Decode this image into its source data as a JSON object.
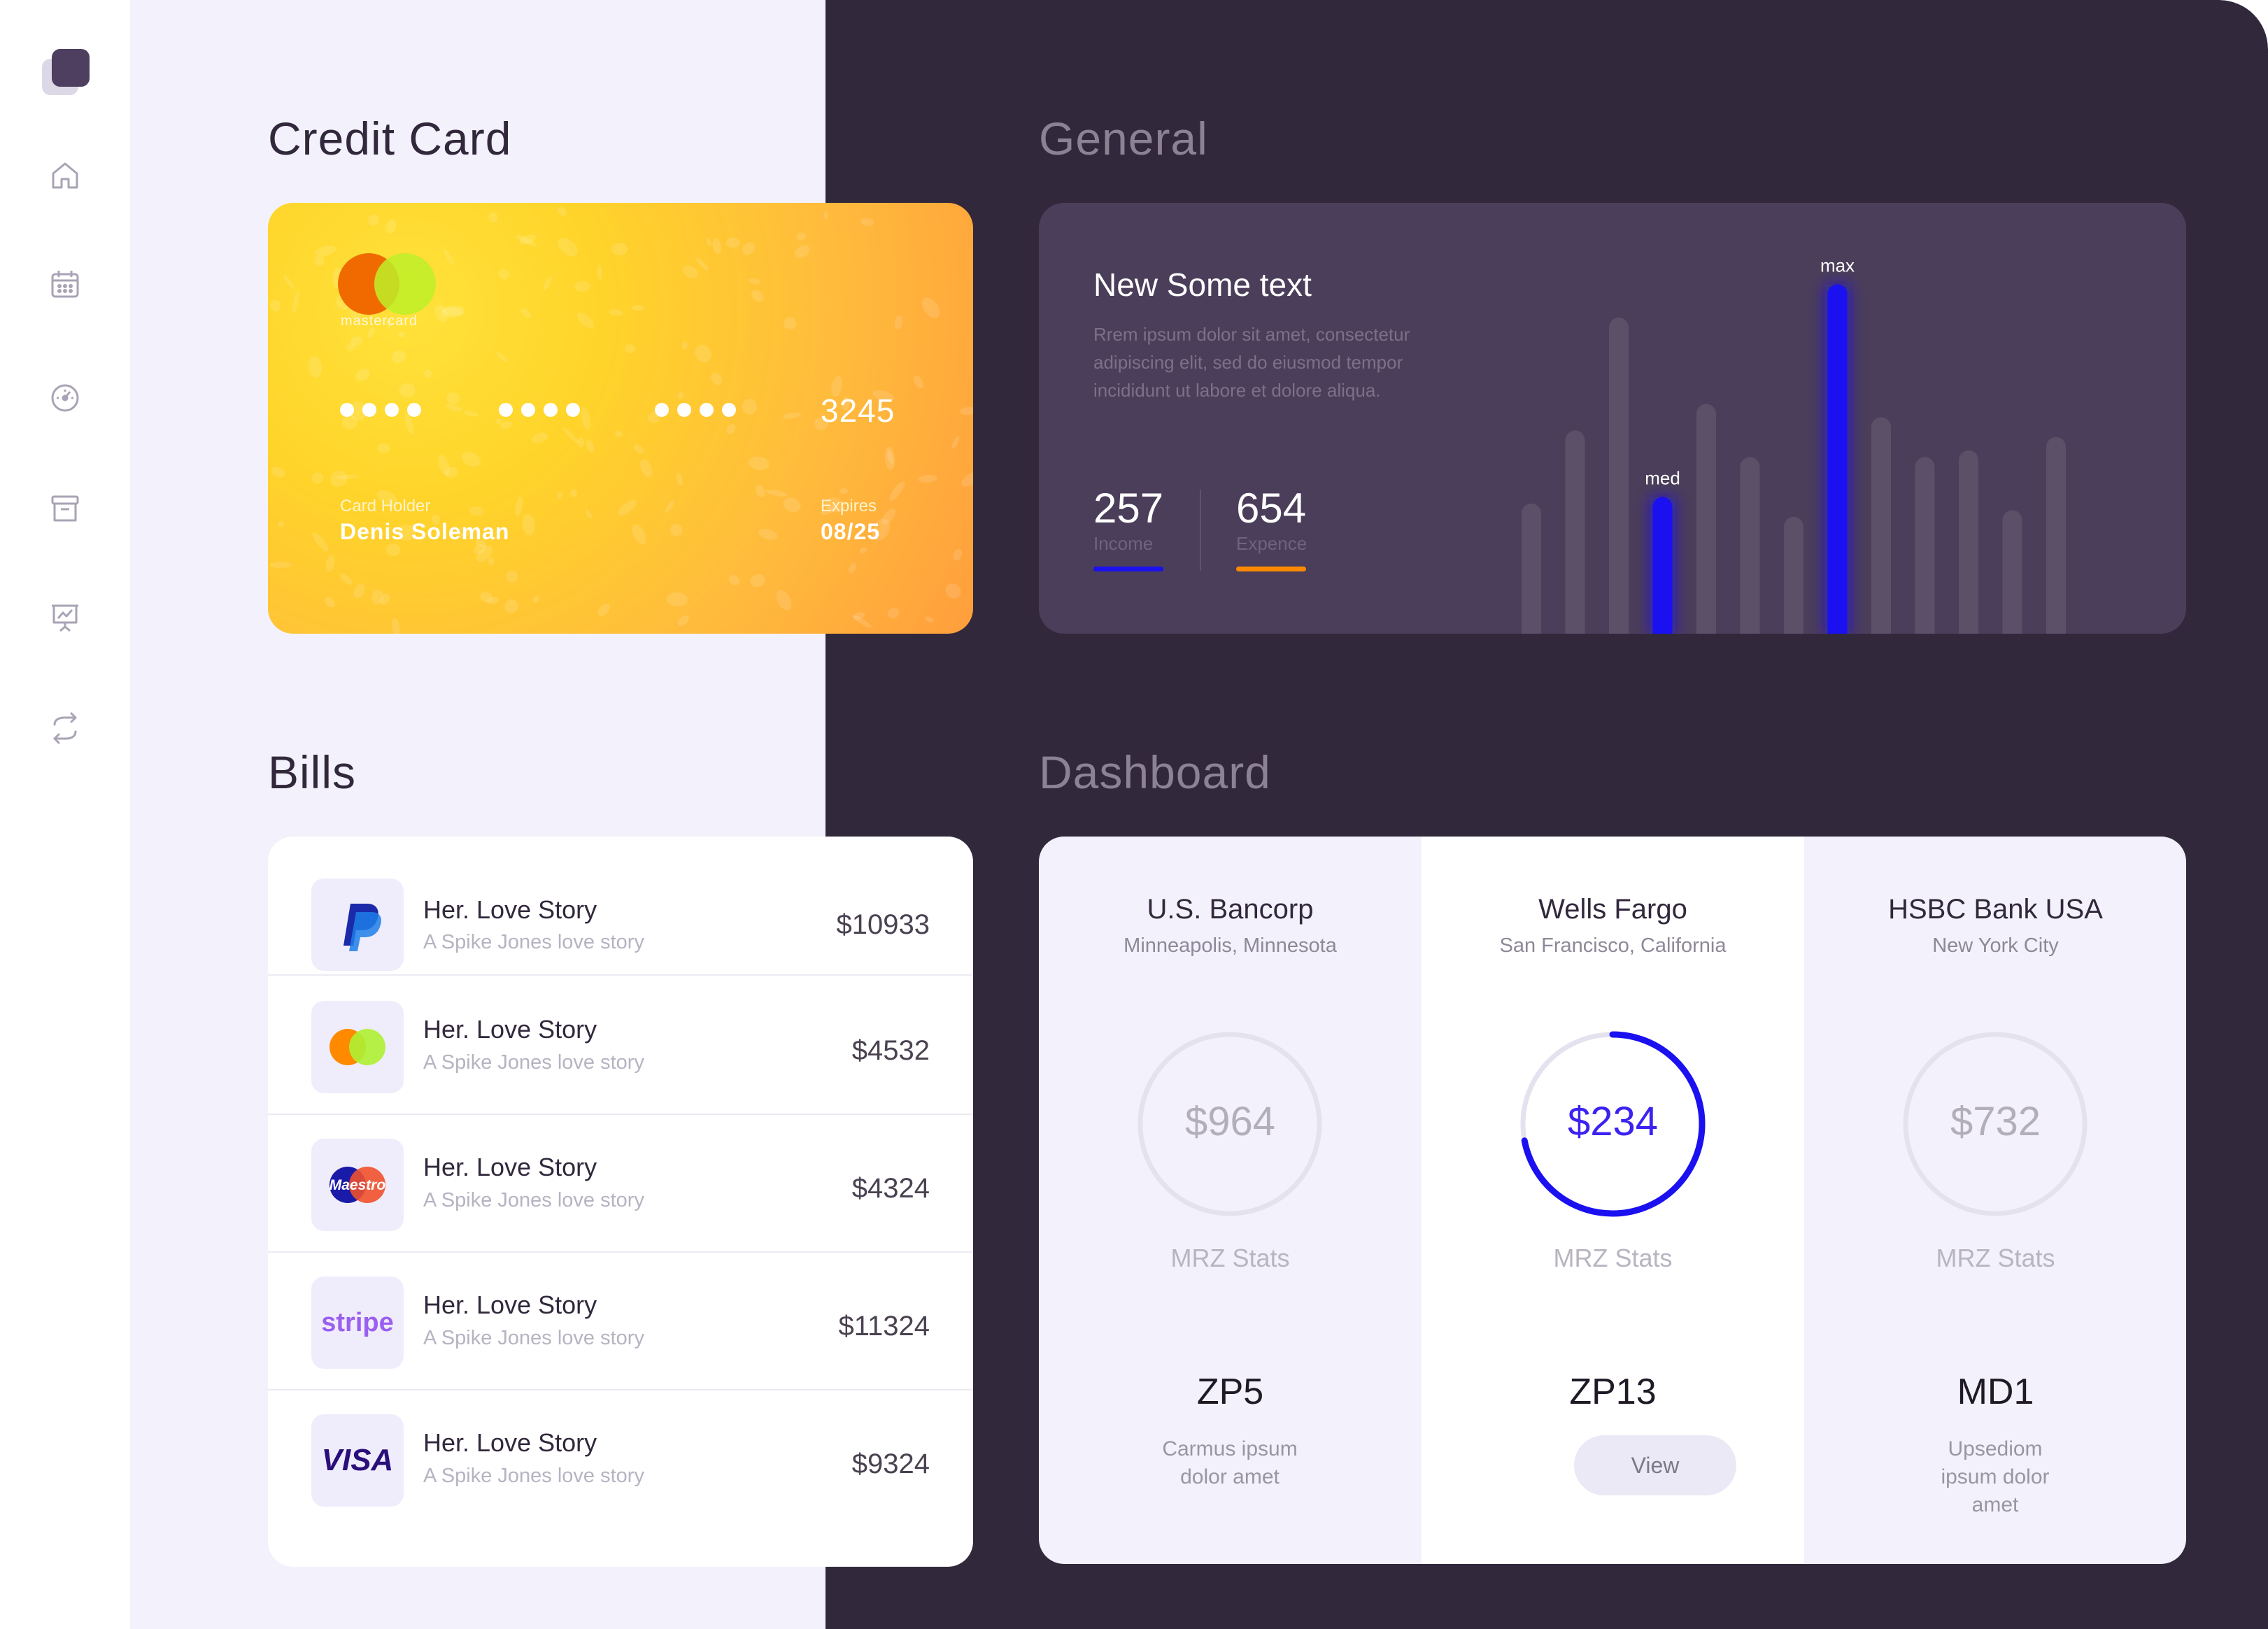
{
  "sidebar": {
    "icons": [
      "home-icon",
      "calendar-icon",
      "dashboard-gauge-icon",
      "archive-icon",
      "presentation-chart-icon",
      "transfer-icon"
    ]
  },
  "sections": {
    "credit_card": "Credit Card",
    "general": "General",
    "bills": "Bills",
    "dashboard": "Dashboard"
  },
  "card": {
    "brand": "mastercard",
    "number_last4": "3245",
    "holder_label": "Card Holder",
    "holder_name": "Denis Soleman",
    "expires_label": "Expires",
    "expires_value": "08/25"
  },
  "general": {
    "title": "New Some text",
    "description": "Rrem ipsum dolor sit amet, consectetur adipiscing elit, sed do eiusmod tempor incididunt ut labore et dolore  aliqua.",
    "income_value": "257",
    "income_label": "Income",
    "expense_value": "654",
    "expense_label": "Expence",
    "colors": {
      "income": "#1a10f0",
      "expense": "#ff8a00",
      "bar": "#5c5068"
    }
  },
  "chart_data": {
    "type": "bar",
    "values": [
      20,
      31,
      48,
      21,
      35,
      27,
      18,
      53,
      33,
      27,
      28,
      19,
      30
    ],
    "highlights": [
      {
        "index": 3,
        "label": "med"
      },
      {
        "index": 7,
        "label": "max"
      }
    ]
  },
  "bills": [
    {
      "icon": "paypal-icon",
      "title": "Her. Love Story",
      "subtitle": "A Spike Jones love story",
      "amount": "$10933"
    },
    {
      "icon": "mastercard-icon",
      "title": "Her. Love Story",
      "subtitle": "A Spike Jones love story",
      "amount": "$4532"
    },
    {
      "icon": "maestro-icon",
      "brand_text": "Maestro",
      "title": "Her. Love Story",
      "subtitle": "A Spike Jones love story",
      "amount": "$4324"
    },
    {
      "icon": "stripe-icon",
      "brand_text": "stripe",
      "title": "Her. Love Story",
      "subtitle": "A Spike Jones love story",
      "amount": "$11324"
    },
    {
      "icon": "visa-icon",
      "brand_text": "VISA",
      "title": "Her. Love Story",
      "subtitle": "A Spike Jones love story",
      "amount": "$9324"
    }
  ],
  "dashboard": [
    {
      "name": "U.S. Bancorp",
      "location": "Minneapolis, Minnesota",
      "amount": "$964",
      "stat_label": "MRZ Stats",
      "code": "ZP5",
      "note": "Carmus ipsum dolor amet",
      "progress": 0
    },
    {
      "name": "Wells Fargo",
      "location": "San Francisco, California",
      "amount": "$234",
      "stat_label": "MRZ Stats",
      "code": "ZP13",
      "button": "View",
      "progress": 0.72
    },
    {
      "name": "HSBC Bank USA",
      "location": "New York City",
      "amount": "$732",
      "stat_label": "MRZ Stats",
      "code": "MD1",
      "note": "Upsediom ipsum dolor amet",
      "progress": 0
    }
  ]
}
